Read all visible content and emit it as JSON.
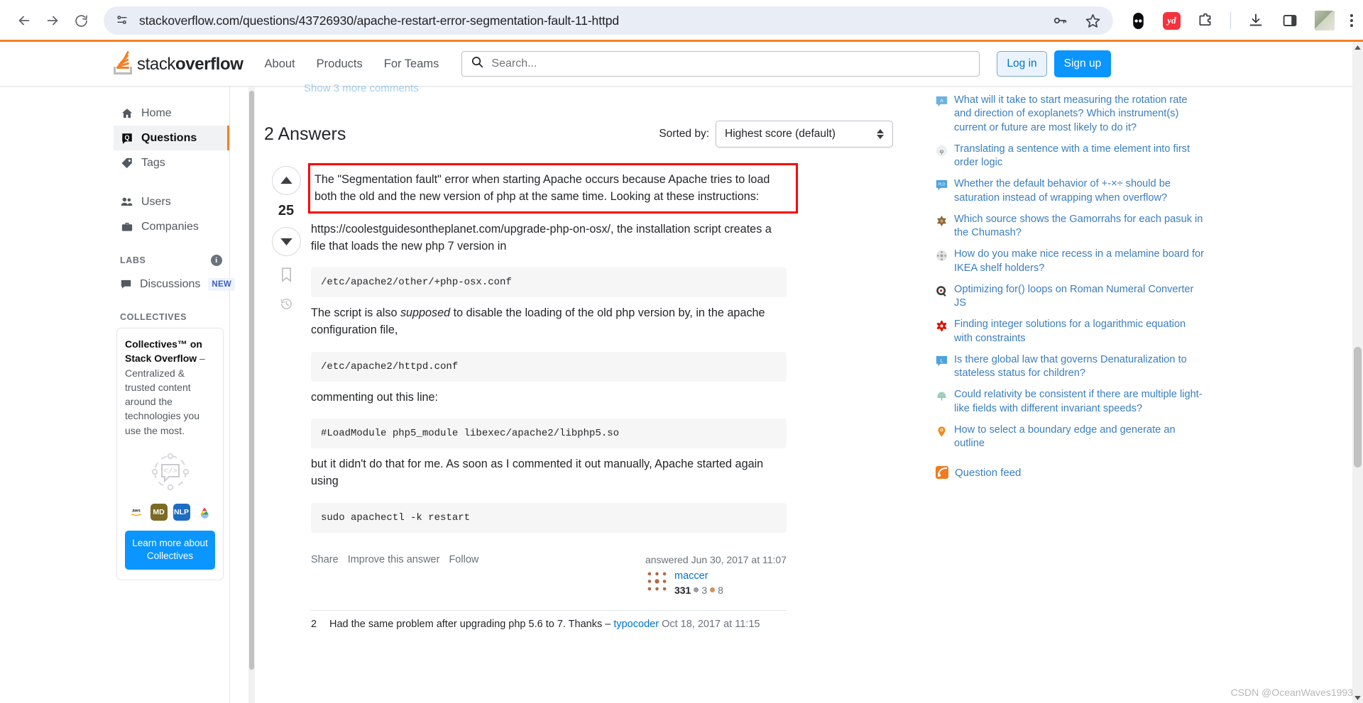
{
  "browser": {
    "url": "stackoverflow.com/questions/43726930/apache-restart-error-segmentation-fault-11-httpd",
    "back_title": "Back",
    "forward_title": "Forward",
    "reload_title": "Reload",
    "site_info_title": "View site information",
    "password_icon": "key-icon",
    "bookmark_icon": "star-icon",
    "extensions": [
      {
        "name": "bitwarden-extension-icon",
        "label": ""
      },
      {
        "name": "youdao-extension-icon",
        "label": "yd"
      },
      {
        "name": "extensions-puzzle-icon",
        "label": ""
      },
      {
        "name": "downloads-icon",
        "label": ""
      },
      {
        "name": "side-panel-icon",
        "label": ""
      },
      {
        "name": "profile-avatar",
        "label": ""
      },
      {
        "name": "chrome-menu-icon",
        "label": ""
      }
    ]
  },
  "so_header": {
    "logo_text_light": "stack",
    "logo_text_bold": "overflow",
    "nav": [
      {
        "label": "About"
      },
      {
        "label": "Products"
      },
      {
        "label": "For Teams"
      }
    ],
    "search_placeholder": "Search...",
    "search_value": "",
    "login_label": "Log in",
    "signup_label": "Sign up"
  },
  "sidebar": {
    "items": [
      {
        "label": "Home",
        "icon": "home-icon",
        "active": false
      },
      {
        "label": "Questions",
        "icon": "question-mark-icon",
        "active": true
      },
      {
        "label": "Tags",
        "icon": "tag-icon",
        "active": false
      },
      {
        "label": "Users",
        "icon": "users-icon",
        "active": false
      },
      {
        "label": "Companies",
        "icon": "briefcase-icon",
        "active": false
      }
    ],
    "labs_heading": "LABS",
    "labs_info_icon": "info-icon",
    "discussions_label": "Discussions",
    "discussions_badge": "NEW",
    "collectives_heading": "COLLECTIVES",
    "collectives_card": {
      "title_bold": "Collectives™ on Stack Overflow",
      "title_rest": " – Centralized & trusted content around the technologies you use the most.",
      "tags": [
        {
          "label": "aws",
          "color": "#ffffff"
        },
        {
          "label": "MD",
          "color": "#7a6a24"
        },
        {
          "label": "NLP",
          "color": "#1b6ec2"
        },
        {
          "label": "gcp",
          "color": "#ffffff"
        }
      ],
      "button_label": "Learn more about Collectives"
    }
  },
  "main": {
    "faded_top_text": "Show 3 more comments",
    "answers_count_label": "2 Answers",
    "sorted_by_label": "Sorted by:",
    "sort_value": "Highest score (default)",
    "answer": {
      "vote_count": "25",
      "upvote_icon": "arrow-up-icon",
      "downvote_icon": "arrow-down-icon",
      "bookmark_icon": "bookmark-icon",
      "history_icon": "history-icon",
      "highlight_color": "#ff0000",
      "highlighted_text": "The \"Segmentation fault\" error when starting Apache occurs because Apache tries to load both the old and the new version of php at the same time. Looking at these instructions:",
      "link_text": "https://coolestguidesontheplanet.com/upgrade-php-on-osx/",
      "after_link_text": ", the installation script creates a file that loads the new php 7 version in",
      "code_1": "/etc/apache2/other/+php-osx.conf",
      "para_2_a": "The script is also ",
      "para_2_em": "supposed",
      "para_2_b": " to disable the loading of the old php version by, in the apache configuration file,",
      "code_2": "/etc/apache2/httpd.conf",
      "para_3": "commenting out this line:",
      "code_3": "#LoadModule php5_module libexec/apache2/libphp5.so",
      "para_4": "but it didn't do that for me. As soon as I commented it out manually, Apache started again using",
      "code_4": "sudo apachectl -k restart",
      "footer_links": [
        "Share",
        "Improve this answer",
        "Follow"
      ],
      "answered_when": "answered Jun 30, 2017 at 11:07",
      "user_name": "maccer",
      "user_rep": "331",
      "silver_badges": "3",
      "bronze_badges": "8"
    },
    "comment": {
      "score": "2",
      "text": "Had the same problem after upgrading php 5.6 to 7. Thanks – ",
      "author": "typocoder",
      "time": "Oct 18, 2017 at 11:15"
    }
  },
  "rightbar": {
    "hot_questions": [
      {
        "text": "What will it take to start measuring the rotation rate and direction of exoplanets? Which instrument(s) current or future are most likely to do it?",
        "icon": "astronomy-site-icon",
        "color": "#6cb2e0",
        "glyph": "A"
      },
      {
        "text": "Translating a sentence with a time element into first order logic",
        "icon": "philosophy-site-icon",
        "color": "#e8e8e8",
        "glyph": "φ"
      },
      {
        "text": "Whether the default behavior of +-×÷ should be saturation instead of wrapping when overflow?",
        "icon": "pldesign-site-icon",
        "color": "#4fa3dd",
        "glyph": "PLD"
      },
      {
        "text": "Which source shows the Gamorrahs for each pasuk in the Chumash?",
        "icon": "judaism-site-icon",
        "color": "#8a6b3a",
        "glyph": "✡"
      },
      {
        "text": "How do you make nice recess in a melamine board for IKEA shelf holders?",
        "icon": "diy-site-icon",
        "color": "#d8d8d8",
        "glyph": "✣"
      },
      {
        "text": "Optimizing for() loops on Roman Numeral Converter JS",
        "icon": "codereview-site-icon",
        "color": "#3b3b3b",
        "glyph": "ⓡ"
      },
      {
        "text": "Finding integer solutions for a logarithmic equation with constraints",
        "icon": "mathematica-site-icon",
        "color": "#dd1100",
        "glyph": "✷"
      },
      {
        "text": "Is there global law that governs Denaturalization to stateless status for children?",
        "icon": "law-site-icon",
        "color": "#4fa3dd",
        "glyph": "L"
      },
      {
        "text": "Could relativity be consistent if there are multiple light-like fields with different invariant speeds?",
        "icon": "physics-site-icon",
        "color": "#9ecfc0",
        "glyph": "☂"
      },
      {
        "text": "How to select a boundary edge and generate an outline",
        "icon": "blender-site-icon",
        "color": "#f08a1e",
        "glyph": "◉"
      }
    ],
    "feed_label": "Question feed",
    "feed_icon": "rss-icon"
  },
  "watermark": "CSDN @OceanWaves1993"
}
